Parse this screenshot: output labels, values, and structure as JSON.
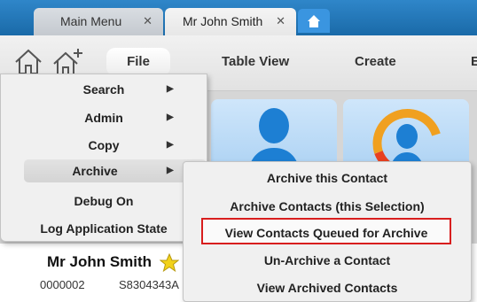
{
  "tabs": [
    {
      "label": "Main Menu",
      "close": "✕"
    },
    {
      "label": "Mr John Smith",
      "close": "✕"
    }
  ],
  "toolbar": {
    "menus": [
      "File",
      "Table View",
      "Create",
      "E"
    ]
  },
  "file_menu": {
    "items": [
      {
        "label": "Search",
        "arrow": "▶"
      },
      {
        "label": "Admin",
        "arrow": "▶"
      },
      {
        "label": "Copy",
        "arrow": "▶"
      },
      {
        "label": "Archive",
        "arrow": "▶"
      },
      {
        "label": "Debug On"
      },
      {
        "label": "Log Application State"
      }
    ]
  },
  "archive_menu": {
    "items": [
      "Archive this Contact",
      "Archive Contacts (this Selection)",
      "View Contacts Queued for Archive",
      "Un-Archive a Contact",
      "View Archived Contacts"
    ]
  },
  "contact": {
    "name": "Mr John Smith",
    "id": "0000002",
    "nric": "S8304343A"
  },
  "colors": {
    "tabstrip": "#1a6aa8",
    "highlight_border": "#d81e1e",
    "star": "#f2d21a"
  }
}
